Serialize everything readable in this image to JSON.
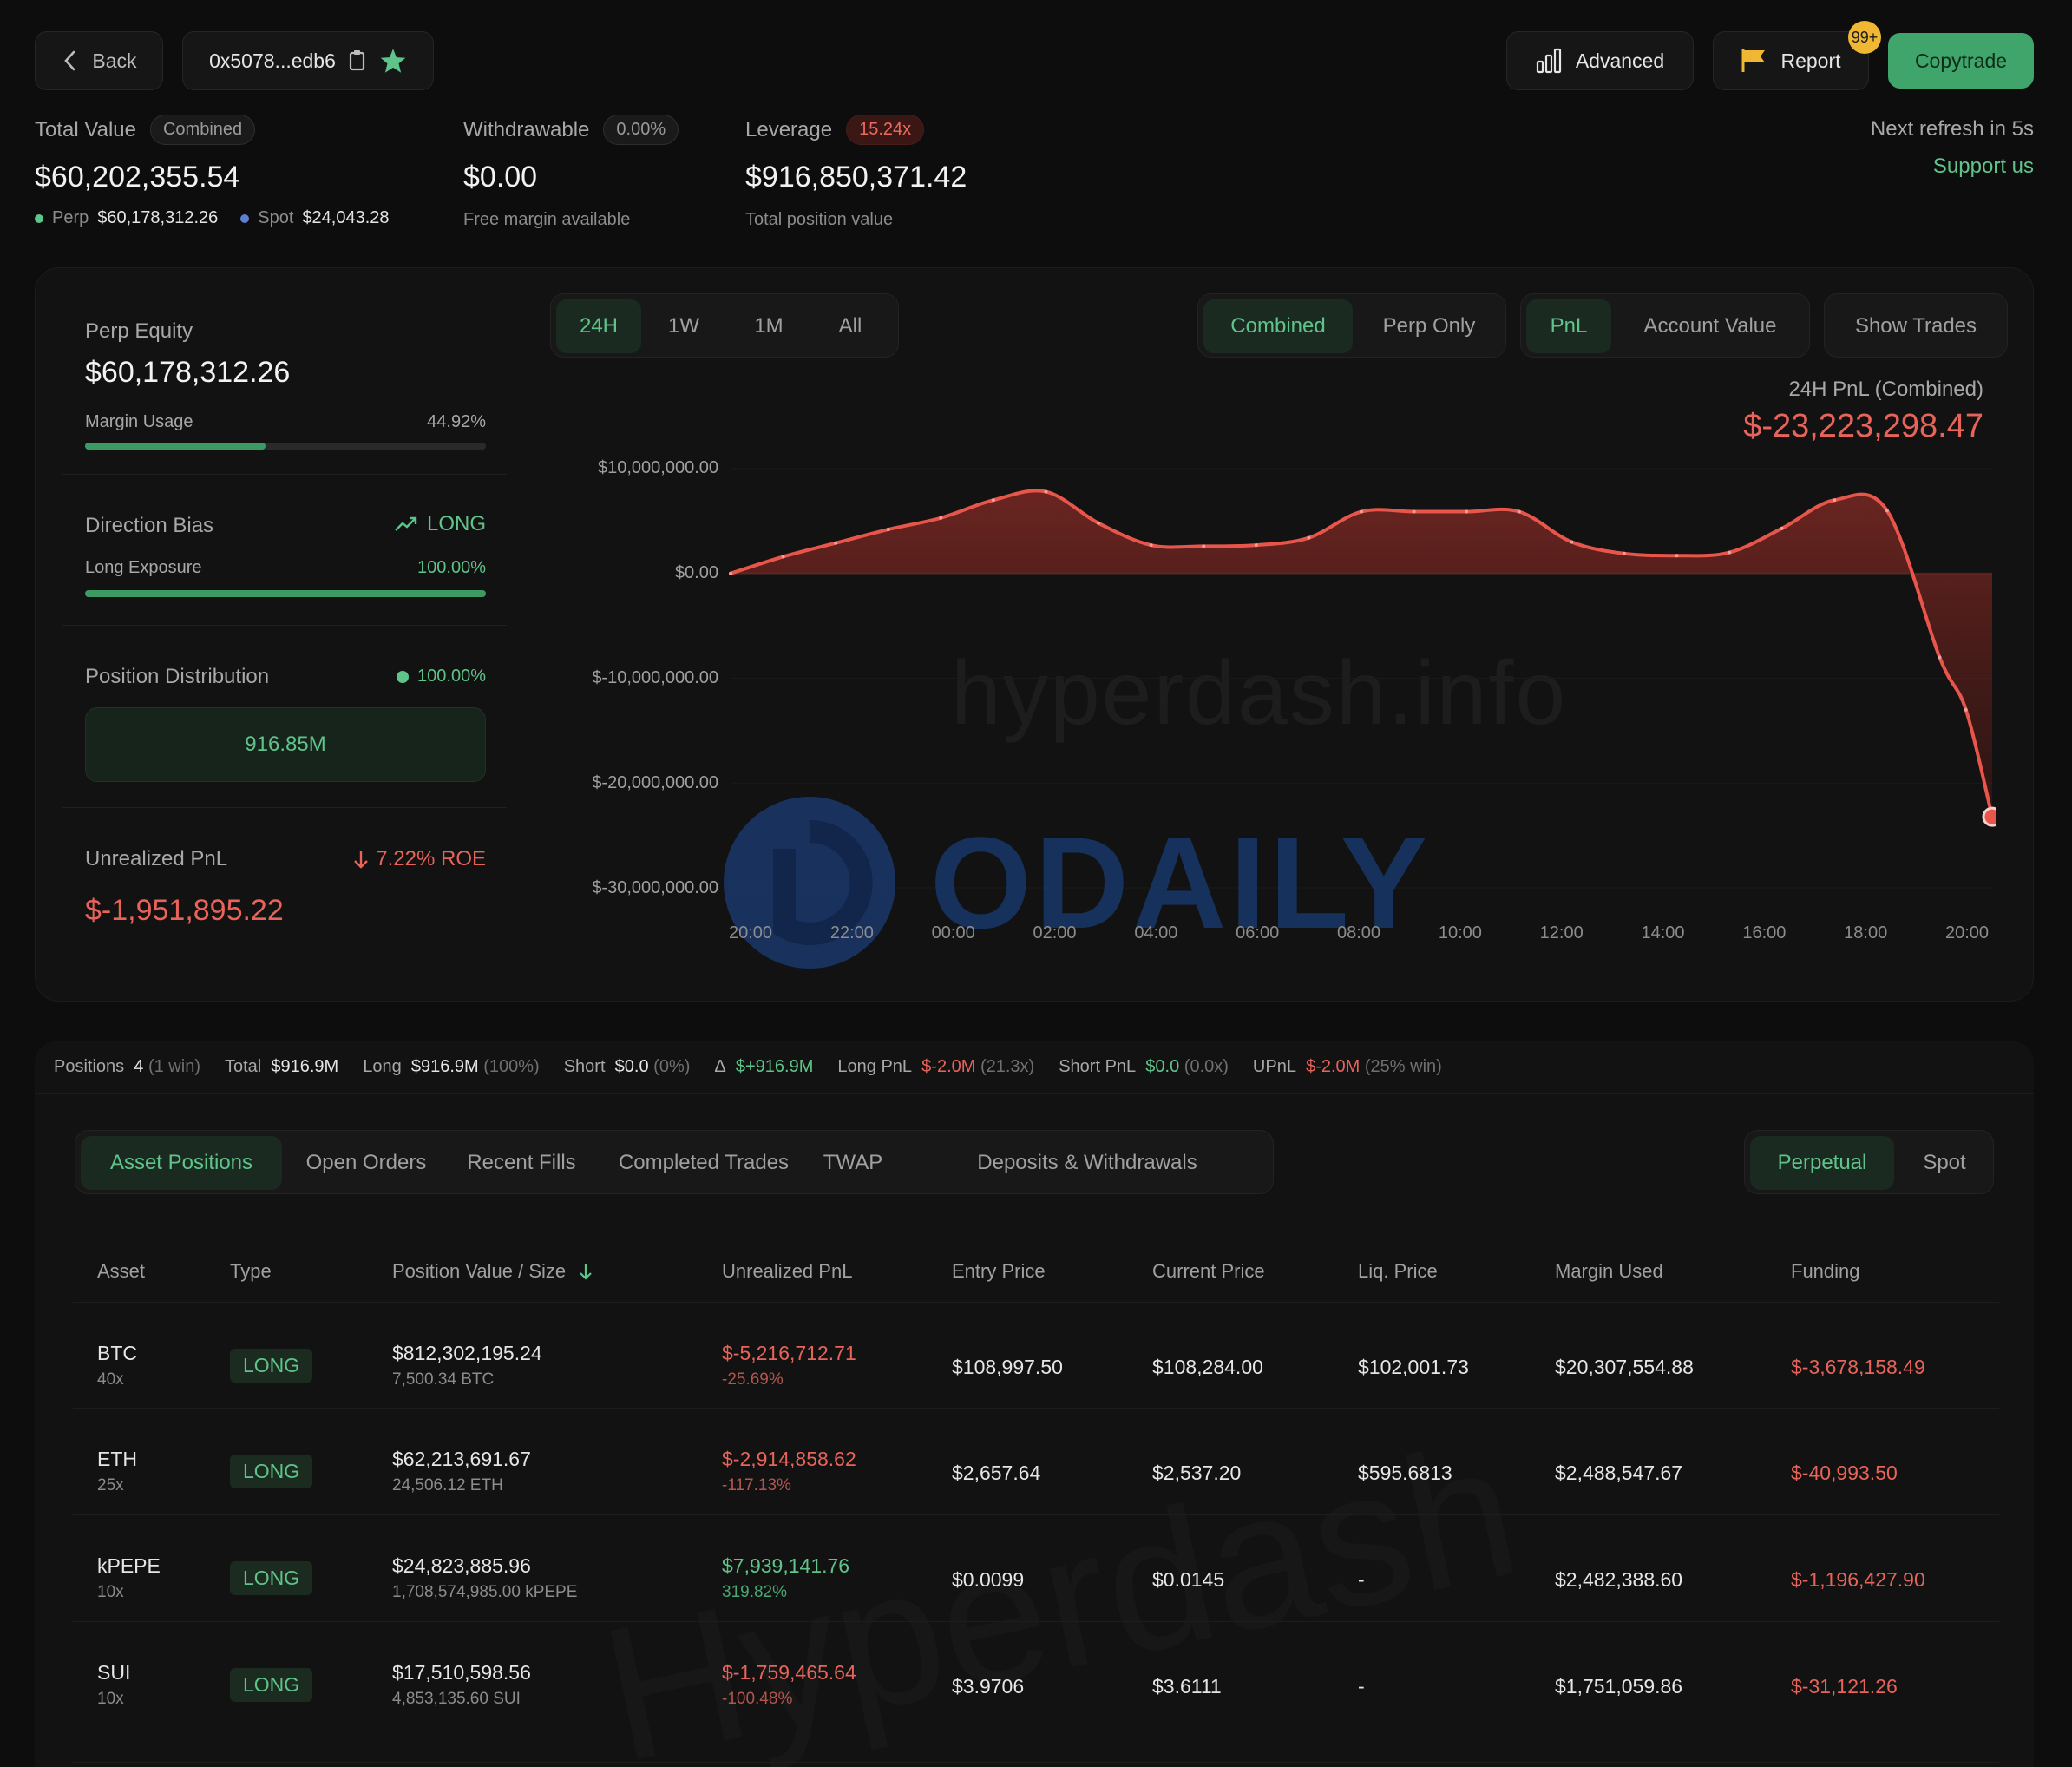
{
  "header": {
    "back_label": "Back",
    "address": "0x5078...edb6",
    "advanced_label": "Advanced",
    "report_label": "Report",
    "report_badge": "99+",
    "copytrade_label": "Copytrade",
    "refresh_text": "Next refresh in 5s",
    "support_label": "Support us"
  },
  "summary": {
    "total_value": {
      "label": "Total Value",
      "pill": "Combined",
      "value": "$60,202,355.54",
      "perp_label": "Perp",
      "perp_value": "$60,178,312.26",
      "spot_label": "Spot",
      "spot_value": "$24,043.28"
    },
    "withdrawable": {
      "label": "Withdrawable",
      "pill": "0.00%",
      "value": "$0.00",
      "sub": "Free margin available"
    },
    "leverage": {
      "label": "Leverage",
      "pill": "15.24x",
      "value": "$916,850,371.42",
      "sub": "Total position value"
    }
  },
  "sidebar": {
    "perp_equity_label": "Perp Equity",
    "perp_equity_value": "$60,178,312.26",
    "margin_usage_label": "Margin Usage",
    "margin_usage_value": "44.92%",
    "margin_usage_frac": 0.4492,
    "direction_label": "Direction Bias",
    "direction_value": "LONG",
    "long_exposure_label": "Long Exposure",
    "long_exposure_value": "100.00%",
    "long_exposure_frac": 1.0,
    "distribution_label": "Position Distribution",
    "distribution_value": "100.00%",
    "distribution_box": "916.85M",
    "upnl_label": "Unrealized PnL",
    "upnl_roe": "7.22% ROE",
    "upnl_value": "$-1,951,895.22"
  },
  "chart_controls": {
    "ranges": [
      "24H",
      "1W",
      "1M",
      "All"
    ],
    "scope": [
      "Combined",
      "Perp Only"
    ],
    "metric": [
      "PnL",
      "Account Value"
    ],
    "show_trades": "Show Trades",
    "pnl_title": "24H PnL (Combined)",
    "pnl_value": "$-23,223,298.47",
    "watermark": "hyperdash.info",
    "watermark2": "ODAILY"
  },
  "chart_data": {
    "type": "area",
    "x": [
      "20:00",
      "21:00",
      "22:00",
      "23:00",
      "00:00",
      "01:00",
      "02:00",
      "03:00",
      "04:00",
      "05:00",
      "06:00",
      "07:00",
      "08:00",
      "09:00",
      "10:00",
      "11:00",
      "12:00",
      "13:00",
      "14:00",
      "15:00",
      "16:00",
      "17:00",
      "18:00",
      "19:00",
      "19:30",
      "20:00"
    ],
    "y": [
      0,
      1600000,
      2900000,
      4200000,
      5300000,
      7000000,
      7800000,
      4800000,
      2700000,
      2600000,
      2700000,
      3400000,
      5900000,
      5900000,
      5900000,
      5900000,
      3000000,
      1900000,
      1700000,
      2000000,
      4300000,
      7000000,
      6000000,
      -8000000,
      -13000000,
      -23223298
    ],
    "y_ticks": [
      "$10,000,000.00",
      "$0.00",
      "$-10,000,000.00",
      "$-20,000,000.00",
      "$-30,000,000.00"
    ],
    "x_ticks": [
      "20:00",
      "22:00",
      "00:00",
      "02:00",
      "04:00",
      "06:00",
      "08:00",
      "10:00",
      "12:00",
      "14:00",
      "16:00",
      "18:00",
      "20:00"
    ],
    "ylim": [
      -30000000,
      10000000
    ],
    "color": "#e8554b"
  },
  "stats": {
    "positions_label": "Positions",
    "positions_value": "4",
    "positions_note": "(1 win)",
    "total_label": "Total",
    "total_value": "$916.9M",
    "long_label": "Long",
    "long_value": "$916.9M",
    "long_note": "(100%)",
    "short_label": "Short",
    "short_value": "$0.0",
    "short_note": "(0%)",
    "delta_label": "Δ",
    "delta_value": "$+916.9M",
    "longpnl_label": "Long PnL",
    "longpnl_value": "$-2.0M",
    "longpnl_note": "(21.3x)",
    "shortpnl_label": "Short PnL",
    "shortpnl_value": "$0.0",
    "shortpnl_note": "(0.0x)",
    "upnl_label": "UPnL",
    "upnl_value": "$-2.0M",
    "upnl_note": "(25% win)"
  },
  "tabs": [
    "Asset Positions",
    "Open Orders",
    "Recent Fills",
    "Completed Trades",
    "TWAP",
    "Deposits & Withdrawals"
  ],
  "market_tabs": [
    "Perpetual",
    "Spot"
  ],
  "table": {
    "headers": [
      "Asset",
      "Type",
      "Position Value / Size",
      "Unrealized PnL",
      "Entry Price",
      "Current Price",
      "Liq. Price",
      "Margin Used",
      "Funding"
    ],
    "rows": [
      {
        "asset": "BTC",
        "lev": "40x",
        "type": "LONG",
        "value": "$812,302,195.24",
        "size": "7,500.34 BTC",
        "pnl": "$-5,216,712.71",
        "pnl_pct": "-25.69%",
        "entry": "$108,997.50",
        "current": "$108,284.00",
        "liq": "$102,001.73",
        "margin": "$20,307,554.88",
        "funding": "$-3,678,158.49"
      },
      {
        "asset": "ETH",
        "lev": "25x",
        "type": "LONG",
        "value": "$62,213,691.67",
        "size": "24,506.12 ETH",
        "pnl": "$-2,914,858.62",
        "pnl_pct": "-117.13%",
        "entry": "$2,657.64",
        "current": "$2,537.20",
        "liq": "$595.6813",
        "margin": "$2,488,547.67",
        "funding": "$-40,993.50"
      },
      {
        "asset": "kPEPE",
        "lev": "10x",
        "type": "LONG",
        "value": "$24,823,885.96",
        "size": "1,708,574,985.00 kPEPE",
        "pnl": "$7,939,141.76",
        "pnl_pct": "319.82%",
        "entry": "$0.0099",
        "current": "$0.0145",
        "liq": "-",
        "margin": "$2,482,388.60",
        "funding": "$-1,196,427.90"
      },
      {
        "asset": "SUI",
        "lev": "10x",
        "type": "LONG",
        "value": "$17,510,598.56",
        "size": "4,853,135.60 SUI",
        "pnl": "$-1,759,465.64",
        "pnl_pct": "-100.48%",
        "entry": "$3.9706",
        "current": "$3.6111",
        "liq": "-",
        "margin": "$1,751,059.86",
        "funding": "$-31,121.26"
      }
    ]
  },
  "colors": {
    "accent": "#5fc48a",
    "negative": "#e8645a",
    "background": "#0d0d0d",
    "card": "#121212"
  }
}
